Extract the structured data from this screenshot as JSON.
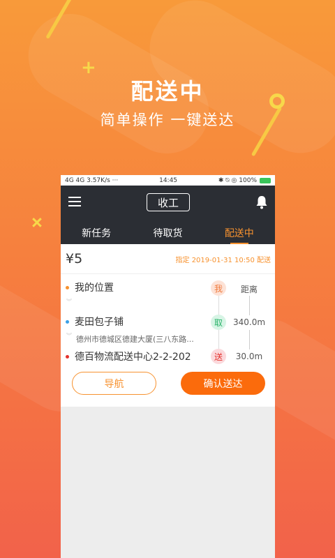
{
  "hero": {
    "title": "配送中",
    "subtitle": "简单操作 一键送达"
  },
  "status_bar": {
    "left": "4G 4G 3.57K/s ···",
    "time": "14:45",
    "right": "✱ ⍉ ◎ 100%"
  },
  "app_bar": {
    "status_toggle": "收工"
  },
  "tabs": [
    {
      "label": "新任务",
      "active": false
    },
    {
      "label": "待取货",
      "active": false
    },
    {
      "label": "配送中",
      "active": true
    }
  ],
  "order": {
    "price": "¥5",
    "deadline": "指定 2019-01-31 10:50 配送",
    "my_location": "我的位置",
    "pickup_name": "麦田包子铺",
    "pickup_address": "德州市德城区德建大厦(三八东路...",
    "dropoff_name": "德百物流配送中心2-2-202",
    "badge_me": "我",
    "badge_pickup": "取",
    "badge_dropoff": "送",
    "distance_label": "距离",
    "distance_pickup": "340.0m",
    "distance_dropoff": "30.0m"
  },
  "actions": {
    "navigate": "导航",
    "confirm": "确认送达"
  },
  "colors": {
    "accent": "#f7922f",
    "confirm_button": "#fb6b0c",
    "header_dark": "#2b2e34",
    "badge_me_bg": "#fde2d6",
    "badge_pickup_bg": "#d7f4e5",
    "badge_dropoff_bg": "#fbd9dc"
  }
}
